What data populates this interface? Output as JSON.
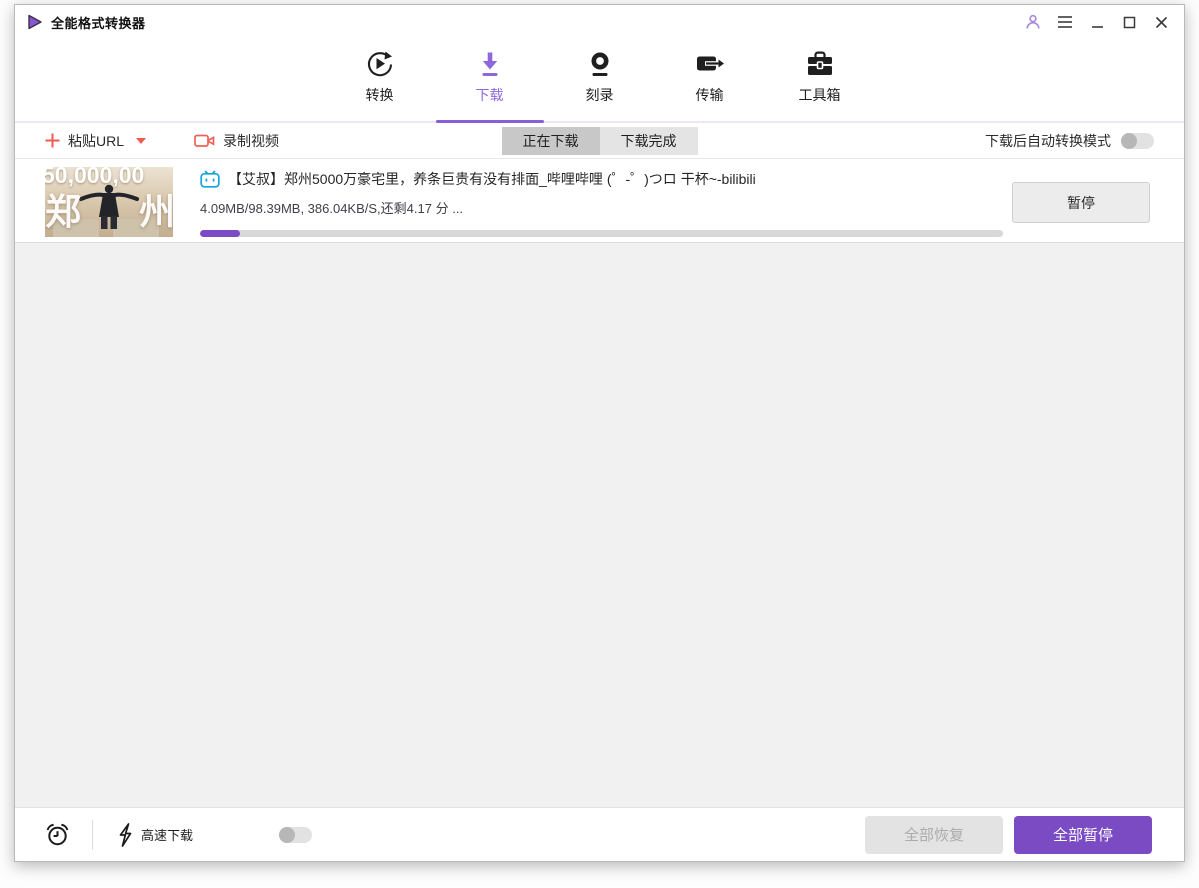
{
  "window": {
    "title": "全能格式转换器"
  },
  "nav": {
    "tabs": [
      {
        "label": "转换",
        "active": false
      },
      {
        "label": "下载",
        "active": true
      },
      {
        "label": "刻录",
        "active": false
      },
      {
        "label": "传输",
        "active": false
      },
      {
        "label": "工具箱",
        "active": false
      }
    ]
  },
  "toolbar": {
    "paste_url": "粘贴URL",
    "record_video": "录制视频",
    "downloading_tab": "正在下载",
    "completed_tab": "下载完成",
    "auto_convert_label": "下载后自动转换模式",
    "auto_convert_enabled": false
  },
  "downloads": {
    "items": [
      {
        "source": "bilibili",
        "title": "【艾叔】郑州5000万豪宅里，养条巨贵有没有排面_哔哩哔哩 (゜-゜)つロ 干杯~-bilibili",
        "status_text": "4.09MB/98.39MB, 386.04KB/S,还剩4.17 分 ...",
        "progress_percent": 5,
        "action_label": "暂停",
        "thumbnail": {
          "overlay_top": "50,000,00",
          "overlay_left": "郑",
          "overlay_right": "州"
        }
      }
    ]
  },
  "footer": {
    "high_speed_label": "高速下载",
    "high_speed_enabled": false,
    "resume_all": "全部恢复",
    "pause_all": "全部暂停"
  },
  "colors": {
    "accent_purple": "#7b4bc4",
    "active_tab_purple": "#8d68dd",
    "action_red": "#f05b51",
    "bilibili_blue": "#12a5dc",
    "seg_active_bg": "#c8c8c8",
    "list_bg": "#f1f1f1"
  }
}
